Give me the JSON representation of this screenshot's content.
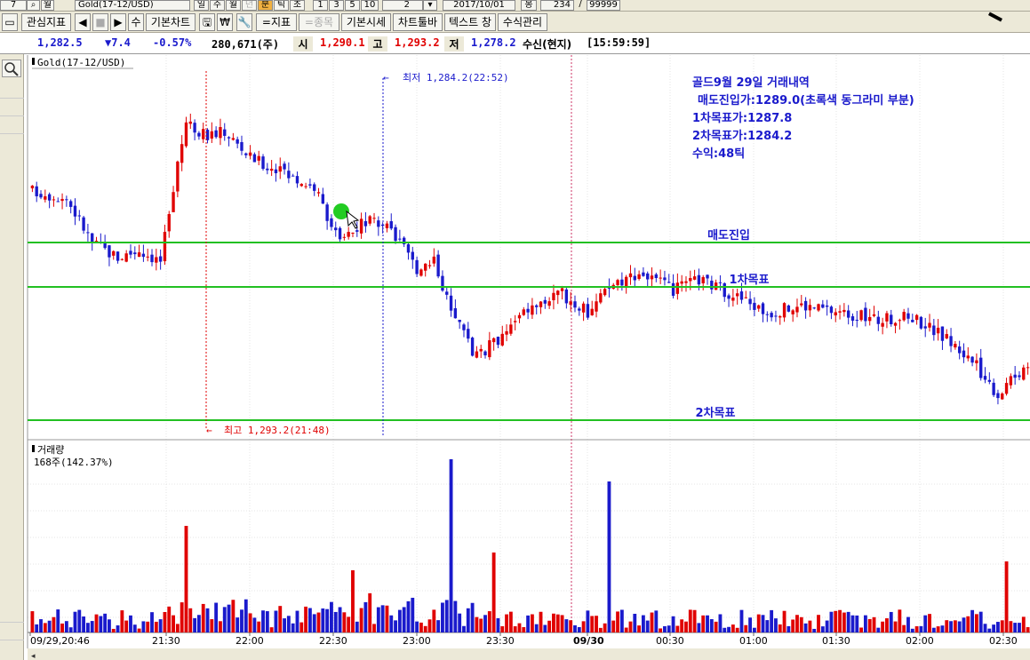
{
  "toolbar_top": {
    "period_buttons": [
      "일",
      "주",
      "월",
      "년",
      "분",
      "틱",
      "초"
    ],
    "active_period": "분",
    "interval_buttons": [
      "1",
      "3",
      "5",
      "10"
    ],
    "interval_value": "2",
    "date_value": "2017/10/01",
    "count_label": "봉",
    "count_value": "234",
    "total_value": "99999",
    "symbol": "Gold(17-12/USD)"
  },
  "toolbar": {
    "items": [
      "관심지표",
      "◀",
      "■",
      "▶",
      "수",
      "기본차트",
      "🖫",
      "₩",
      "🔧",
      "=지표",
      "=종목",
      "기본시세",
      "차트툴바",
      "텍스트 창",
      "수식관리"
    ]
  },
  "quote": {
    "last": "1,282.5",
    "change": "▼7.4",
    "pct": "-0.57%",
    "volume": "280,671(주)",
    "open_label": "시",
    "open": "1,290.1",
    "high_label": "고",
    "high": "1,293.2",
    "low_label": "저",
    "low": "1,278.2",
    "status": "수신(현지)",
    "time": "[15:59:59]"
  },
  "colors": {
    "up": "#e00000",
    "down": "#1a1acc",
    "annotation": "#1a1acc",
    "target_line": "#22c022",
    "entry_marker": "#22cc22"
  },
  "chart_data": {
    "type": "candlestick",
    "symbol_title": "Gold(17-12/USD)",
    "price_range": [
      1278.2,
      1293.2
    ],
    "high_annotation": "최고 1,293.2(21:48)",
    "low_annotation": "최저 1,284.2(22:52)",
    "note_lines": [
      "골드9월 29일 거래내역",
      "매도진입가:1289.0(초록색 동그라미 부분)",
      "1차목표가:1287.8",
      "2차목표가:1284.2",
      "수익:48틱"
    ],
    "horizontal_lines": [
      {
        "label": "매도진입",
        "price": 1289.0
      },
      {
        "label": "1차목표",
        "price": 1287.8
      },
      {
        "label": "2차목표",
        "price": 1284.2
      }
    ],
    "volume_title": "거래량",
    "volume_value": "168주(142.37%)",
    "x_ticks": [
      "09/29,20:46",
      "21:30",
      "22:00",
      "22:30",
      "23:00",
      "23:30",
      "09/30",
      "00:30",
      "01:00",
      "01:30",
      "02:00",
      "02:30"
    ],
    "date_change_label": "09/30"
  }
}
